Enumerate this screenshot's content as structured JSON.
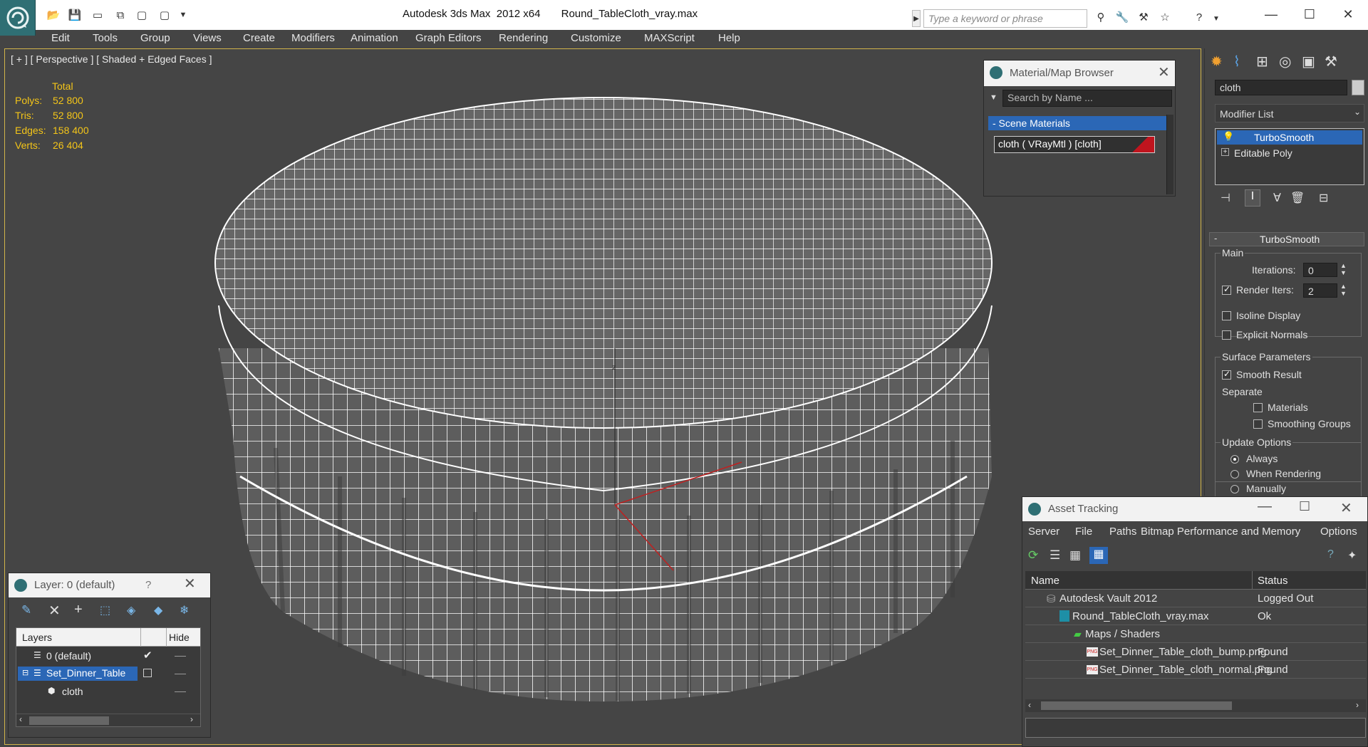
{
  "window": {
    "title": "Autodesk 3ds Max  2012 x64       Round_TableCloth_vray.max",
    "search_placeholder": "Type a keyword or phrase"
  },
  "menu": [
    "Edit",
    "Tools",
    "Group",
    "Views",
    "Create",
    "Modifiers",
    "Animation",
    "Graph Editors",
    "Rendering",
    "Customize",
    "MAXScript",
    "Help"
  ],
  "viewport": {
    "label": "[ + ] [ Perspective ] [ Shaded + Edged Faces ]",
    "stats": {
      "header": "Total",
      "rows": [
        {
          "k": "Polys:",
          "v": "52 800"
        },
        {
          "k": "Tris:",
          "v": "52 800"
        },
        {
          "k": "Edges:",
          "v": "158 400"
        },
        {
          "k": "Verts:",
          "v": "26 404"
        }
      ]
    }
  },
  "material_browser": {
    "title": "Material/Map Browser",
    "search_placeholder": "Search by Name ...",
    "section": "- Scene Materials",
    "item": "cloth  ( VRayMtl ) [cloth]"
  },
  "command_panel": {
    "object_name": "cloth",
    "modifier_list": "Modifier List",
    "stack": [
      "TurboSmooth",
      "Editable Poly"
    ],
    "rollout_title": "TurboSmooth",
    "main_label": "Main",
    "iterations_label": "Iterations:",
    "iterations_value": "0",
    "render_iters_label": "Render Iters:",
    "render_iters_value": "2",
    "isoline_label": "Isoline Display",
    "explicit_normals_label": "Explicit Normals",
    "surface_params_label": "Surface Parameters",
    "smooth_result_label": "Smooth Result",
    "separate_label": "Separate",
    "materials_label": "Materials",
    "smoothing_groups_label": "Smoothing Groups",
    "update_options_label": "Update Options",
    "always_label": "Always",
    "when_rendering_label": "When Rendering",
    "manually_label": "Manually"
  },
  "asset_tracking": {
    "title": "Asset Tracking",
    "menu": [
      "Server",
      "File",
      "Paths",
      "Bitmap Performance and Memory",
      "Options"
    ],
    "col_name": "Name",
    "col_status": "Status",
    "rows": [
      {
        "name": "Autodesk Vault 2012",
        "status": "Logged Out"
      },
      {
        "name": "Round_TableCloth_vray.max",
        "status": "Ok"
      },
      {
        "name": "Maps / Shaders",
        "status": ""
      },
      {
        "name": "Set_Dinner_Table_cloth_bump.png",
        "status": "Found"
      },
      {
        "name": "Set_Dinner_Table_cloth_normal.png",
        "status": "Found"
      }
    ]
  },
  "layer_panel": {
    "title": "Layer: 0 (default)",
    "help": "?",
    "col_layers": "Layers",
    "col_hide": "Hide",
    "rows": [
      "0 (default)",
      "Set_Dinner_Table",
      "cloth"
    ]
  }
}
